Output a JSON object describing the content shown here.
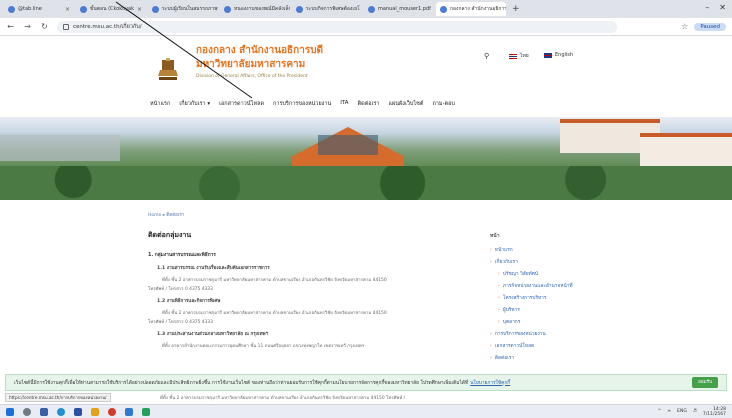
{
  "browser": {
    "tabs": [
      {
        "label": "@tab.line",
        "active": false
      },
      {
        "label": "ขั้นตอน (Ckokoyak",
        "active": false
      },
      {
        "label": "ระบบผู้เรียนในสมรรถภาพรับ",
        "active": false
      },
      {
        "label": "หนองงานของพณ์มีคลังเล็ก",
        "active": false
      },
      {
        "label": "ระบบกิจการพิเศษต้องเยโ",
        "active": false
      },
      {
        "label": "manual_mouser1.pdf",
        "active": false
      },
      {
        "label": "กองกลาง สำนักงานอธิการบดี มศ",
        "active": true
      }
    ],
    "url": "centre.msu.ac.th/เกี่ยวกับ/",
    "profile_label": "Paused"
  },
  "site": {
    "title_line1": "กองกลาง สำนักงานอธิการบดี",
    "title_line2": "มหาวิทยาลัยมหาสารคาม",
    "subtitle": "Division of General Affairs, Office of the President",
    "lang_th": "ไทย",
    "lang_en": "English",
    "nav": [
      "หน้าแรก",
      "เกี่ยวกับเรา ▾",
      "เอกสารดาวน์โหลด",
      "การบริการของหน่วยงาน",
      "ITA",
      "ติดต่อเรา",
      "แผนผังเว็บไซต์",
      "ถาม-ตอบ"
    ]
  },
  "breadcrumb": "Home ▸ ติดต่อเรา",
  "content": {
    "title": "ติดต่อกลุ่มงาน",
    "sections": [
      {
        "head": "1. กลุ่มงานสารบรรณและพิธีการ",
        "subs": [
          {
            "label": "1.1 งานสารบรรณ งานรับเรื่องและสืบค้นเอกสารราชการ",
            "detail": "ที่ตั้ง ชั้น 2 อาคารบรมราชกุมารี มหาวิทยาลัยมหาสารคาม ตำบลขามเรียง อำเภอกันทรวิชัย จังหวัดมหาสารคาม 44150",
            "detail2": "โทรศัพท์ / โทรสาร 0 4375 4333"
          },
          {
            "label": "1.2 งานพิธีการและกิจการพิเศษ",
            "detail": "ที่ตั้ง ชั้น 2 อาคารบรมราชกุมารี มหาวิทยาลัยมหาสารคาม ตำบลขามเรียง อำเภอกันทรวิชัย จังหวัดมหาสารคาม 44150",
            "detail2": "โทรศัพท์ / โทรสาร 0 4375 4333"
          },
          {
            "label": "1.3 งานประสานงานส่วนกลางมหาวิทยาลัย ณ กรุงเทพฯ",
            "detail": "ที่ตั้ง อาคารสำนักงานคณะกรรมการอุดมศึกษา ชั้น 11 ถนนศรีอยุธยา แขวงทุ่งพญาไท เขตราชเทวี กรุงเทพฯ",
            "detail2": ""
          }
        ]
      }
    ],
    "behind_banner_line": "ที่ตั้ง ชั้น 2 อาคารบรมราชกุมารี มหาวิทยาลัยมหาสารคาม ตำบลขามเรียง อำเภอกันทรวิชัย จังหวัดมหาสารคาม 44150 โทรศัพท์ /"
  },
  "sidebar": {
    "title": "หน้า",
    "items": [
      {
        "label": "หน้าแรก",
        "sub": false
      },
      {
        "label": "เกี่ยวกับเรา",
        "sub": false
      },
      {
        "label": "ปรัชญา วิสัยทัศน์",
        "sub": true
      },
      {
        "label": "ภารกิจหน่วยงานและอำนาจหน้าที่",
        "sub": true
      },
      {
        "label": "โครงสร้างการบริหาร",
        "sub": true
      },
      {
        "label": "ผู้บริหาร",
        "sub": true
      },
      {
        "label": "บุคลากร",
        "sub": true
      },
      {
        "label": "การบริการของหน่วยงาน",
        "sub": false
      },
      {
        "label": "เอกสารดาวน์โหลด",
        "sub": false
      },
      {
        "label": "ติดต่อเรา",
        "sub": false
      }
    ]
  },
  "cookie": {
    "text": "เว็บไซต์นี้มีการใช้งานคุกกี้เพื่อให้ท่านสามารถใช้บริการได้อย่างปลอดภัยและมีประสิทธิภาพยิ่งขึ้น การใช้งานเว็บไซต์ ของท่านถือว่าท่านยอมรับการใช้คุกกี้ตามนโยบายการจัดการคุกกี้ของมหาวิทยาลัย โปรดศึกษาเพิ่มเติมได้ที่",
    "link": "นโยบายการใช้คุกกี้",
    "accept": "ยอมรับ"
  },
  "status_url": "https://centre.msu.ac.th/การบริการของหน่วยงาน/",
  "taskbar": {
    "tray_lang": "ENG",
    "time": "14:28",
    "date": "7/11/2567"
  }
}
